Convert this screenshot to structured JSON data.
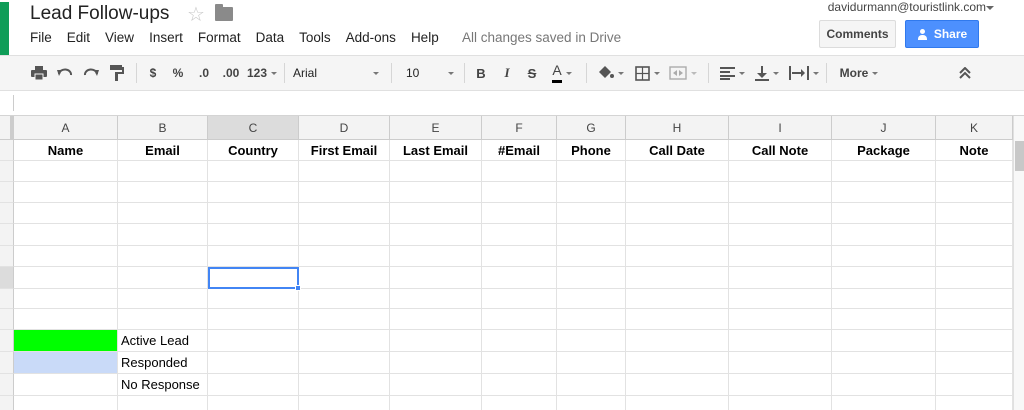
{
  "header": {
    "title": "Lead Follow-ups",
    "account": "davidurmann@touristlink.com",
    "save_status": "All changes saved in Drive",
    "comments_label": "Comments",
    "share_label": "Share",
    "menu": [
      "File",
      "Edit",
      "View",
      "Insert",
      "Format",
      "Data",
      "Tools",
      "Add-ons",
      "Help"
    ]
  },
  "toolbar": {
    "currency": "$",
    "percent": "%",
    "dec_less": ".0",
    "dec_more": ".00",
    "number_format": "123",
    "font": "Arial",
    "font_size": "10",
    "bold": "B",
    "italic": "I",
    "strike": "S",
    "text_color": "A",
    "more": "More"
  },
  "grid": {
    "columns": [
      "A",
      "B",
      "C",
      "D",
      "E",
      "F",
      "G",
      "H",
      "I",
      "J",
      "K"
    ],
    "header_row": [
      "Name",
      "Email",
      "Country",
      "First Email",
      "Last Email",
      "#Email",
      "Phone",
      "Call Date",
      "Call Note",
      "Package",
      "Note"
    ],
    "legend": [
      {
        "label": "Active Lead",
        "color": "#00ff00"
      },
      {
        "label": "Responded",
        "color": "#c9daf8"
      },
      {
        "label": "No Response",
        "color": "#ffffff"
      }
    ]
  },
  "colors": {
    "brand_green": "#0f9d58",
    "share_blue": "#4d90fe",
    "selection_blue": "#4285f4"
  }
}
